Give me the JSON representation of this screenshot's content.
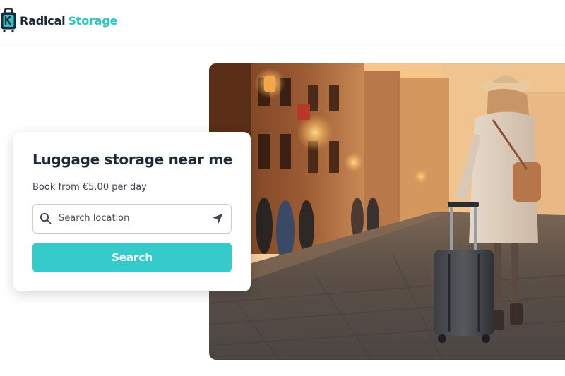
{
  "brand": {
    "name_part1": "Radical",
    "name_part2": "Storage",
    "primary_color": "#1b2a3a",
    "accent_color": "#2fc4c4",
    "logo_icon": "suitcase-icon"
  },
  "hero_image": {
    "icon": "hero-photo"
  },
  "search_card": {
    "title": "Luggage storage near me",
    "subtitle": "Book from €5.00 per day",
    "search": {
      "placeholder": "Search location",
      "value": "",
      "search_icon": "search-icon",
      "locate_icon": "location-arrow-icon"
    },
    "button_label": "Search",
    "button_color": "#36cbcb"
  }
}
